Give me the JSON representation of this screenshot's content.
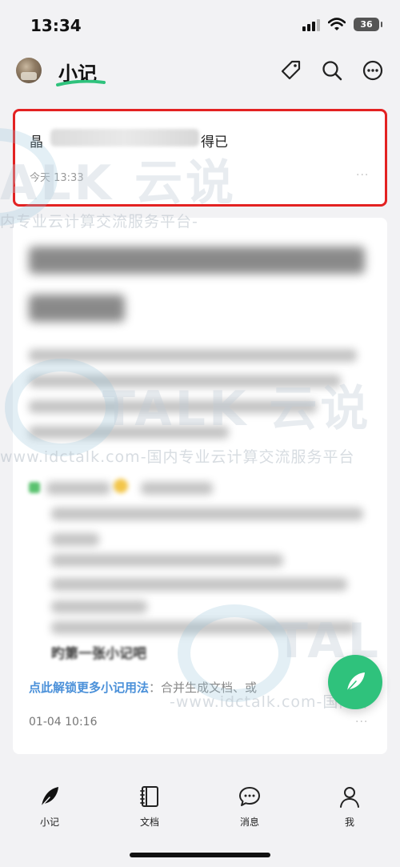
{
  "status_bar": {
    "time": "13:34",
    "battery": "36"
  },
  "header": {
    "title": "小记"
  },
  "note": {
    "title_start": "晶",
    "title_end": "得已",
    "time": "今天 13:33",
    "more": "···"
  },
  "guide": {
    "last_line": "旳第一张小记吧",
    "link_text": "点此解锁更多小记用法",
    "link_suffix": "：合并生成文档、或",
    "time": "01-04 10:16",
    "more": "···"
  },
  "watermark": {
    "brand_small": "ALK 云说",
    "sub_small": "内专业云计算交流服务平台-",
    "brand_large": "TALK 云说",
    "sub_large": "www.idctalk.com-国内专业云计算交流服务平台",
    "brand_bottom": "TAL",
    "sub_bottom": "-www.idctalk.com-国内专"
  },
  "bottom_nav": {
    "items": [
      {
        "label": "小记",
        "icon": "feather-icon"
      },
      {
        "label": "文档",
        "icon": "notebook-icon"
      },
      {
        "label": "消息",
        "icon": "chat-bubble-icon"
      },
      {
        "label": "我",
        "icon": "person-icon"
      }
    ]
  }
}
